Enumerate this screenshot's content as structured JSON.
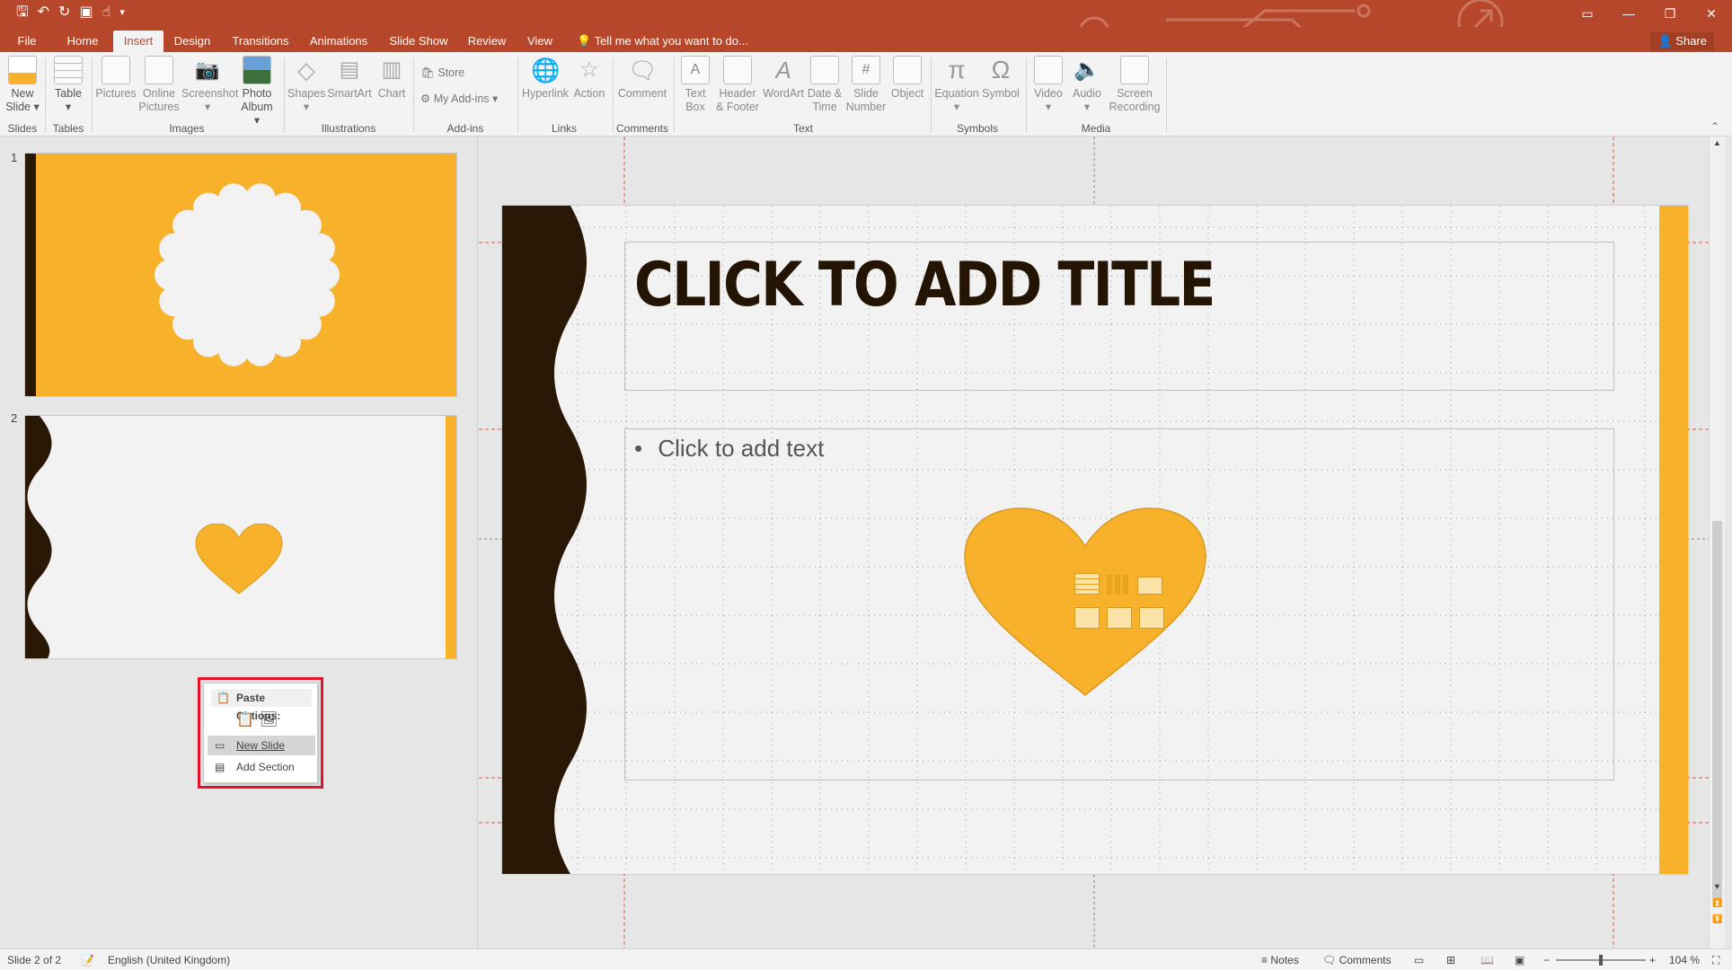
{
  "quick_access": {
    "icons": [
      "save-icon",
      "undo-icon",
      "redo-icon",
      "present-icon",
      "touch-mode-icon",
      "customize-icon"
    ]
  },
  "window": {
    "ribbon_display_icon": "▭",
    "minimize_icon": "—",
    "restore_icon": "❐",
    "close_icon": "✕"
  },
  "tabs": [
    {
      "label": "File"
    },
    {
      "label": "Home"
    },
    {
      "label": "Insert"
    },
    {
      "label": "Design"
    },
    {
      "label": "Transitions"
    },
    {
      "label": "Animations"
    },
    {
      "label": "Slide Show"
    },
    {
      "label": "Review"
    },
    {
      "label": "View"
    }
  ],
  "tell_me": "Tell me what you want to do...",
  "share": "Share",
  "ribbon": {
    "new_slide": [
      "New",
      "Slide"
    ],
    "table": "Table",
    "pictures": "Pictures",
    "online_pictures": [
      "Online",
      "Pictures"
    ],
    "screenshot": "Screenshot",
    "photo_album": [
      "Photo",
      "Album"
    ],
    "shapes": "Shapes",
    "smartart": "SmartArt",
    "chart": "Chart",
    "store": "Store",
    "my_addins": "My Add-ins",
    "hyperlink": "Hyperlink",
    "action": "Action",
    "comment": "Comment",
    "text_box": [
      "Text",
      "Box"
    ],
    "header_footer": [
      "Header",
      "& Footer"
    ],
    "wordart": "WordArt",
    "date_time": [
      "Date &",
      "Time"
    ],
    "slide_number": [
      "Slide",
      "Number"
    ],
    "object": "Object",
    "equation": "Equation",
    "symbol": "Symbol",
    "video": "Video",
    "audio": "Audio",
    "screen_recording": [
      "Screen",
      "Recording"
    ],
    "groups": {
      "slides": "Slides",
      "tables": "Tables",
      "images": "Images",
      "illustrations": "Illustrations",
      "addins": "Add-ins",
      "links": "Links",
      "comments": "Comments",
      "text": "Text",
      "symbols": "Symbols",
      "media": "Media"
    }
  },
  "thumbnails": [
    {
      "number": "1"
    },
    {
      "number": "2"
    }
  ],
  "context_menu": {
    "header": "Paste Options:",
    "items": [
      "New Slide",
      "Add Section"
    ]
  },
  "slide": {
    "title_placeholder": "CLICK TO ADD TITLE",
    "body_placeholder": "Click to add text"
  },
  "status": {
    "slide_info": "Slide 2 of 2",
    "language": "English (United Kingdom)",
    "notes": "Notes",
    "comments": "Comments",
    "zoom": "104 %"
  },
  "colors": {
    "accent_titlebar": "#b7472a",
    "theme_gold": "#f7b12b",
    "theme_dark": "#2a1806",
    "selection_red": "#e8112d"
  }
}
